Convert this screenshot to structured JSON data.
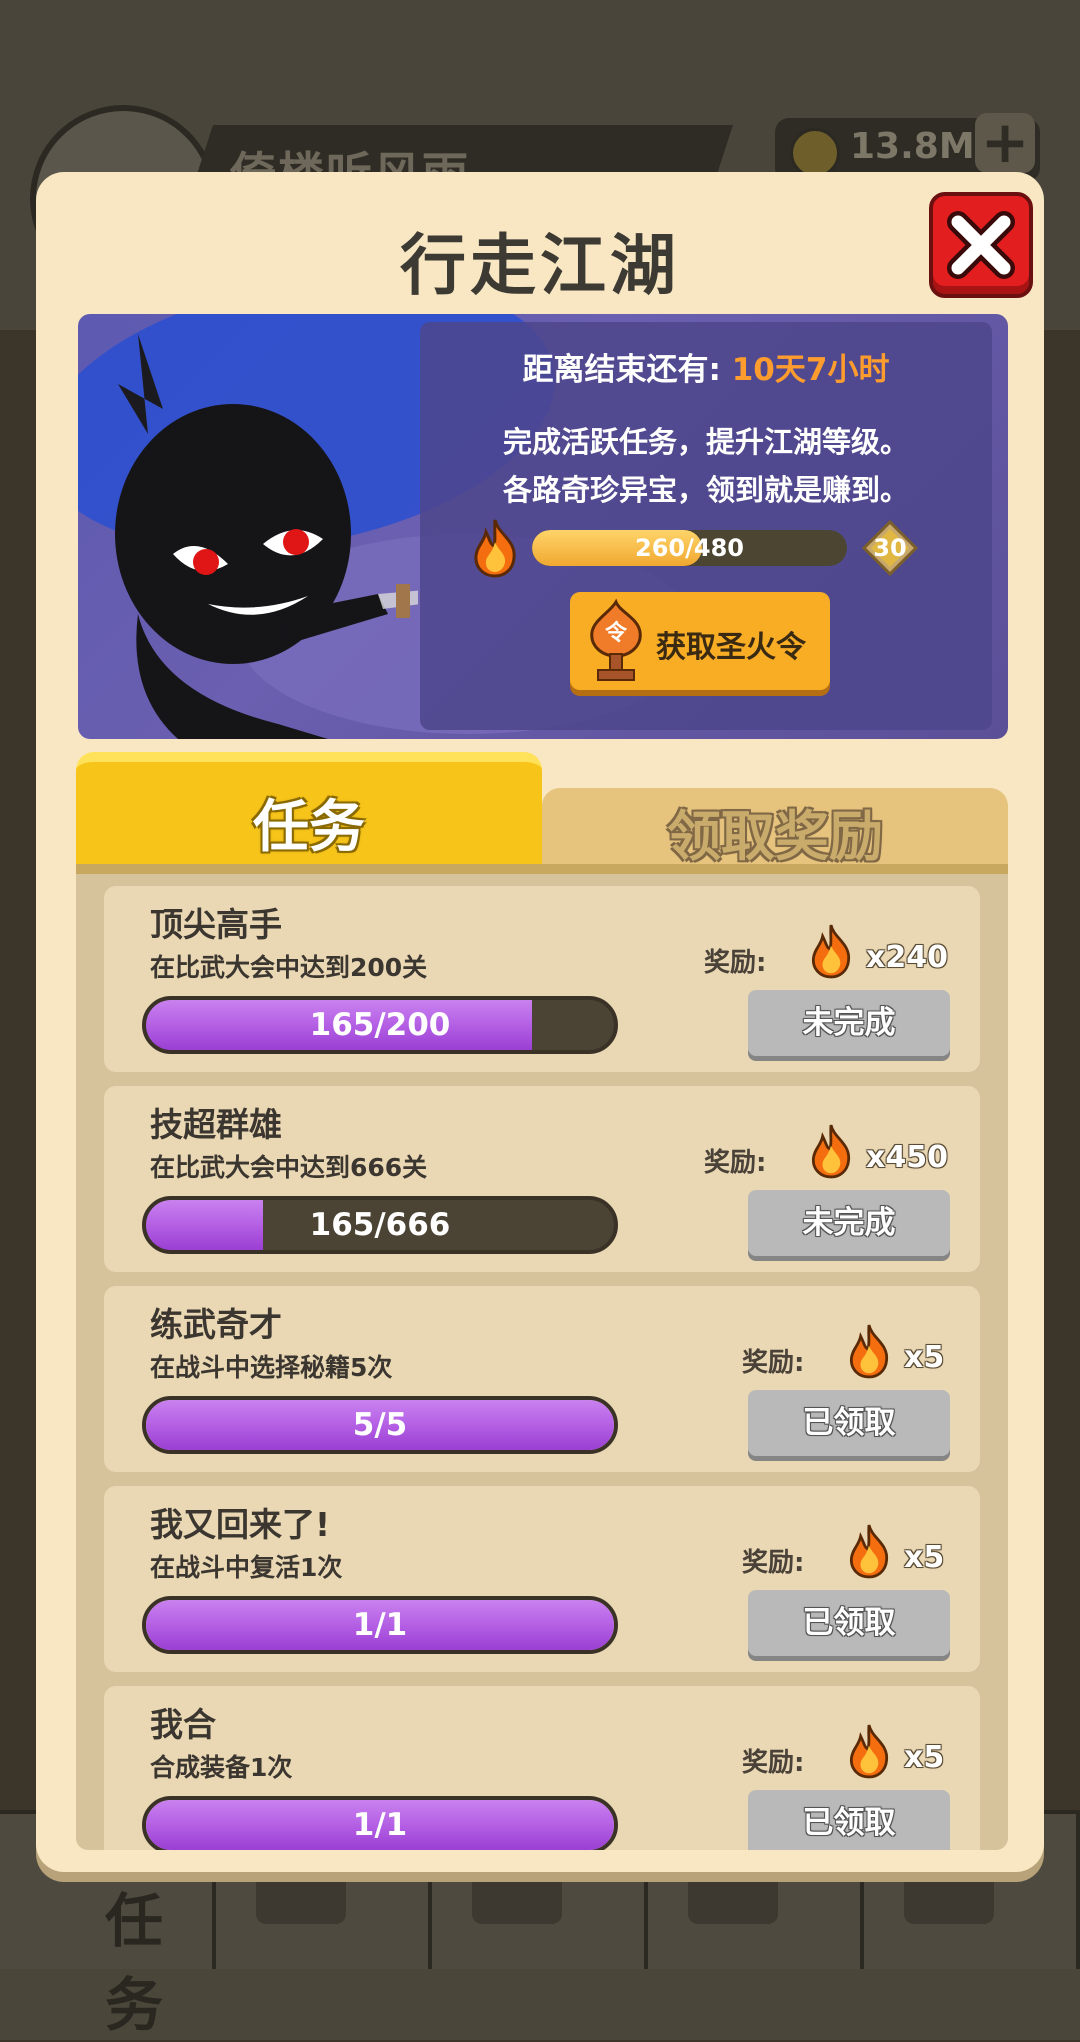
{
  "background": {
    "player_name": "倚楼听风雨",
    "coins": "13.8M",
    "bottom_tab_label": "任务"
  },
  "dialog": {
    "title": "行走江湖",
    "banner": {
      "countdown_label": "距离结束还有: ",
      "countdown_value": "10天7小时",
      "desc_line1": "完成活跃任务，提升江湖等级。",
      "desc_line2": "各路奇珍异宝，领到就是赚到。",
      "progress_text": "260/480",
      "progress_fraction": 0.54,
      "level": "30",
      "fire_token_button": "获取圣火令"
    },
    "tabs": [
      {
        "label": "任务",
        "active": true
      },
      {
        "label": "领取奖励",
        "active": false
      }
    ],
    "reward_prefix": "奖励:",
    "tasks": [
      {
        "name": "顶尖高手",
        "desc": "在比武大会中达到200关",
        "progress": "165/200",
        "fraction": 0.825,
        "reward": "x240",
        "status": "未完成"
      },
      {
        "name": "技超群雄",
        "desc": "在比武大会中达到666关",
        "progress": "165/666",
        "fraction": 0.25,
        "reward": "x450",
        "status": "未完成"
      },
      {
        "name": "练武奇才",
        "desc": "在战斗中选择秘籍5次",
        "progress": "5/5",
        "fraction": 1.0,
        "reward": "x5",
        "status": "已领取"
      },
      {
        "name": "我又回来了!",
        "desc": "在战斗中复活1次",
        "progress": "1/1",
        "fraction": 1.0,
        "reward": "x5",
        "status": "已领取"
      },
      {
        "name": "我合",
        "desc": "合成装备1次",
        "progress": "1/1",
        "fraction": 1.0,
        "reward": "x5",
        "status": "已领取"
      }
    ]
  },
  "icons": {
    "close": "close-icon",
    "fire": "flame-icon",
    "level_badge": "diamond-badge-icon",
    "fire_token": "fire-token-icon",
    "coin": "coin-icon",
    "plus": "plus-icon"
  },
  "colors": {
    "dialog_bg": "#f8e7c2",
    "accent_yellow": "#f7c51a",
    "close_red": "#e31e1e",
    "progress_purple": "#b663e6",
    "countdown_orange": "#ff9c2e"
  }
}
